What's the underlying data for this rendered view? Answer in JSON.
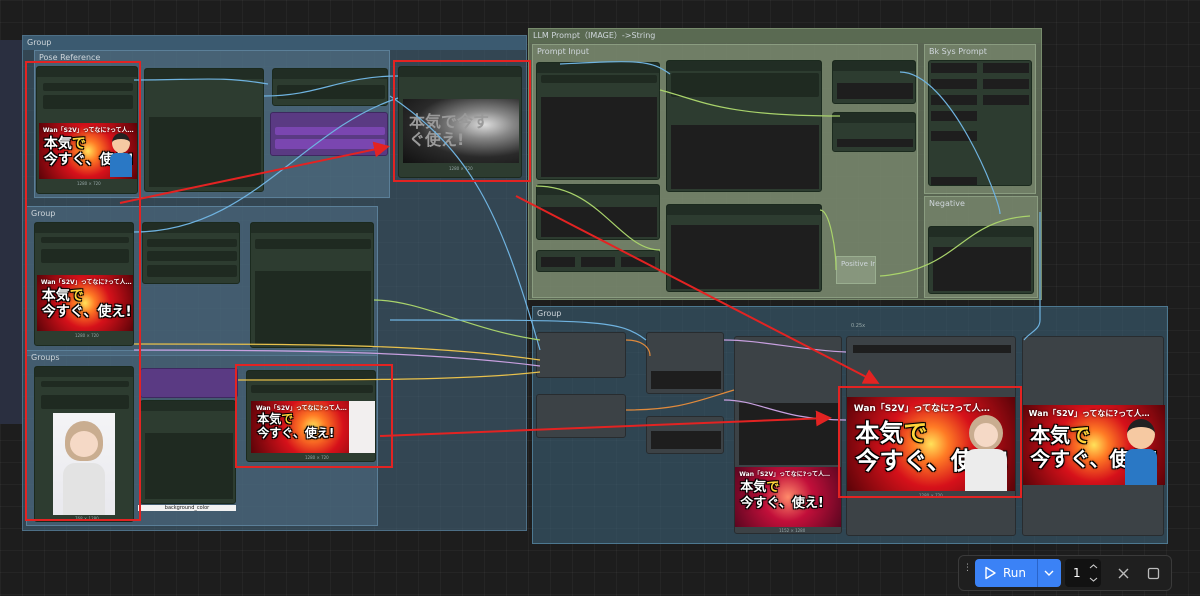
{
  "canvas": {
    "groups": {
      "left_outer": "Group",
      "pose_reference": "Pose Reference",
      "left_mid": "Group",
      "left_bottom": "Groups",
      "llm": "LLM Prompt（IMAGE）->String",
      "prompt_input": "Prompt Input",
      "bk_sys_prompt": "Bk Sys Prompt",
      "negative": "Negative",
      "positive_input": "Positive Input",
      "bottom_right": "Group"
    },
    "captions": {
      "thumb_a": "1280 × 720",
      "thumb_b": "1280 × 720",
      "depth": "1280 × 720",
      "portrait": "768 × 1280",
      "mid_thumb": "1280 × 720",
      "small_out": "1152 × 1280",
      "out_left": "1280 × 720",
      "scale": "0.25x"
    },
    "background_color_label": "background_color",
    "thumbnail": {
      "top_line": "Wan「S2V」ってなに?って人…",
      "word1_a": "本気",
      "word1_b": "で",
      "word2_a": "今すぐ",
      "word2_b": "、使え!",
      "depth_text": "本気で今すぐ使え!"
    },
    "colors": {
      "annotation_red": "#e32322",
      "node_green": "#2d3c30",
      "group_blue": "#3d5566",
      "llm_group": "#5d6b55",
      "run_blue": "#3b82f6"
    }
  },
  "toolbar": {
    "drag_handle_icon": "drag-handle-icon",
    "run_label": "Run",
    "run_icon": "play-icon",
    "dropdown_icon": "chevron-down-icon",
    "batch_count": "1",
    "cancel_icon": "close-icon",
    "stop_icon": "square-icon"
  }
}
